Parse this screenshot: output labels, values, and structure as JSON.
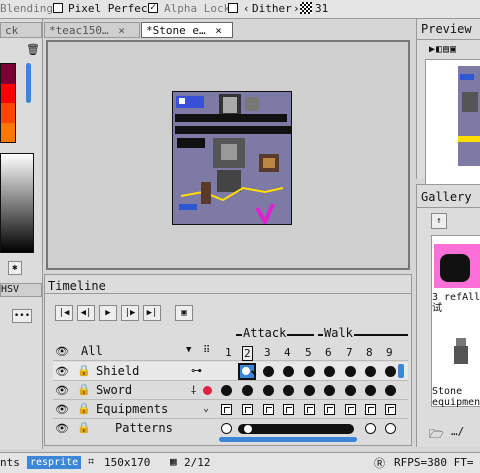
{
  "toolbar": {
    "blending": "Blending",
    "pixel_perfect": "Pixel Perfect",
    "alpha_lock": "Alpha Lock",
    "dither": "Dither",
    "dither_value": "31"
  },
  "tabs": [
    {
      "label": "ck"
    },
    {
      "label": "*teac150…",
      "close": "×"
    },
    {
      "label": "*Stone e…",
      "close": "×"
    }
  ],
  "left_panel": {
    "hsv_label": "HSV"
  },
  "preview": {
    "title": "Preview"
  },
  "gallery": {
    "title": "Gallery",
    "item1": "3 refAll\n试",
    "item2": "Stone\nequipment",
    "path": "…/"
  },
  "timeline": {
    "title": "Timeline",
    "filter": "All",
    "tags": [
      {
        "name": "Attack"
      },
      {
        "name": "Walk"
      }
    ],
    "frames": [
      "1",
      "2",
      "3",
      "4",
      "5",
      "6",
      "7",
      "8",
      "9"
    ],
    "layers": [
      {
        "name": "Shield"
      },
      {
        "name": "Sword"
      },
      {
        "name": "Equipments"
      },
      {
        "name": "Patterns"
      }
    ]
  },
  "status": {
    "left": "nts",
    "app": "resprite",
    "size": "150x170",
    "frames": "2/12",
    "rfps": "RFPS=380 FT="
  },
  "colors": {
    "accent": "#3c86d8",
    "canvas_bg": "#7d7aa6",
    "palette": [
      "#7a0033",
      "#ff0000",
      "#ff7700",
      "#ff4500"
    ]
  }
}
